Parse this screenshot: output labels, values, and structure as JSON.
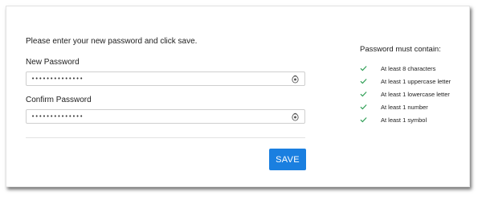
{
  "form": {
    "instruction": "Please enter your new password and click save.",
    "new_password": {
      "label": "New Password",
      "value_mask": "••••••••••••••"
    },
    "confirm_password": {
      "label": "Confirm Password",
      "value_mask": "••••••••••••••"
    },
    "save_label": "SAVE"
  },
  "requirements": {
    "title": "Password must contain:",
    "items": [
      {
        "text": "At least 8 characters",
        "icon": "check-icon"
      },
      {
        "text": "At least 1 uppercase letter",
        "icon": "check-icon"
      },
      {
        "text": "At least 1 lowercase letter",
        "icon": "check-icon"
      },
      {
        "text": "At least 1 number",
        "icon": "check-icon"
      },
      {
        "text": "At least 1 symbol",
        "icon": "check-icon"
      }
    ]
  },
  "icons": {
    "show_password": "eye-icon",
    "requirement_met": "check-icon"
  },
  "colors": {
    "accent": "#1a7fe0",
    "check": "#2e9e55",
    "border": "#cfcfcf"
  }
}
